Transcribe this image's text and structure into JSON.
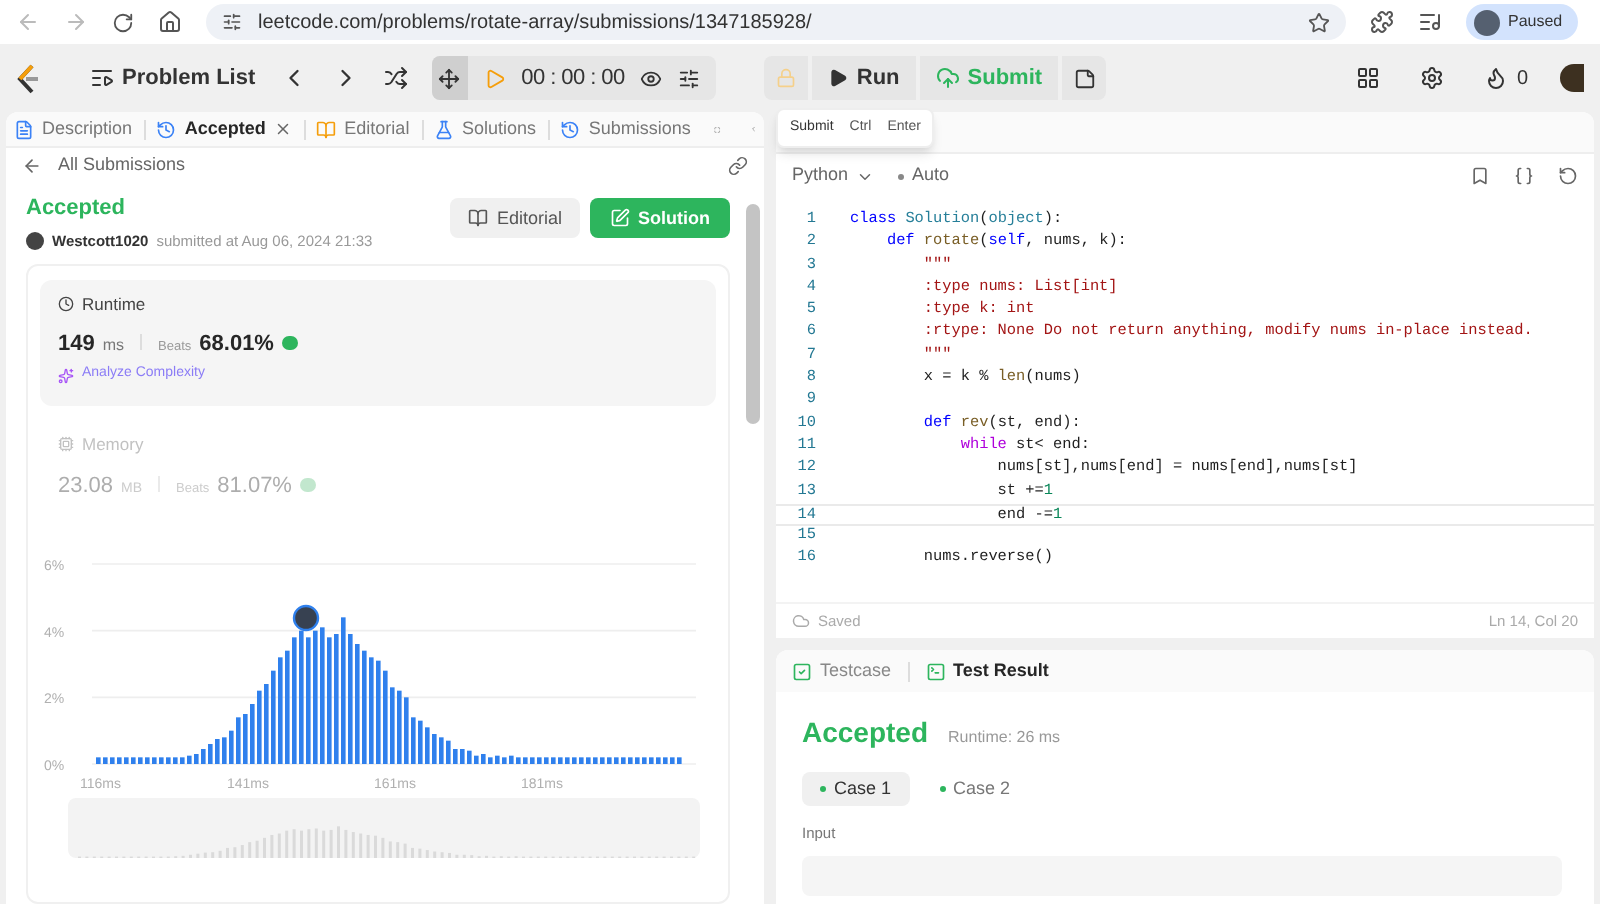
{
  "browser": {
    "url": "leetcode.com/problems/rotate-array/submissions/1347185928/",
    "profile": "Paused"
  },
  "toolbar": {
    "problem_list": "Problem List",
    "timer": "00 : 00 : 00",
    "run": "Run",
    "submit": "Submit",
    "points": "0"
  },
  "tooltip": {
    "label": "Submit",
    "keys": [
      "Ctrl",
      "Enter"
    ]
  },
  "left_tabs": [
    {
      "label": "Description",
      "selected": false
    },
    {
      "label": "Accepted",
      "selected": true
    },
    {
      "label": "Editorial",
      "selected": false
    },
    {
      "label": "Solutions",
      "selected": false
    },
    {
      "label": "Submissions",
      "selected": false
    }
  ],
  "back_link": "All Submissions",
  "submission": {
    "status": "Accepted",
    "user": "Westcott1020",
    "submitted": "submitted at Aug 06, 2024 21:33",
    "editorial_button": "Editorial",
    "solution_button": "Solution"
  },
  "runtime": {
    "title": "Runtime",
    "value": "149",
    "unit": "ms",
    "beats_label": "Beats",
    "beats": "68.01%",
    "analyze": "Analyze Complexity"
  },
  "memory": {
    "title": "Memory",
    "value": "23.08",
    "unit": "MB",
    "beats_label": "Beats",
    "beats": "81.07%"
  },
  "chart_data": {
    "type": "bar",
    "ylim": [
      0,
      6
    ],
    "yticks": [
      {
        "value": 0,
        "label": "0%"
      },
      {
        "value": 2,
        "label": "2%"
      },
      {
        "value": 4,
        "label": "4%"
      },
      {
        "value": 6,
        "label": "6%"
      }
    ],
    "categories": [
      "116ms",
      null,
      null,
      null,
      null,
      null,
      null,
      null,
      null,
      null,
      null,
      null,
      null,
      null,
      null,
      null,
      null,
      null,
      null,
      null,
      null,
      "141ms",
      null,
      null,
      null,
      null,
      null,
      null,
      null,
      null,
      null,
      null,
      null,
      null,
      null,
      null,
      null,
      null,
      null,
      null,
      null,
      null,
      "161ms",
      null,
      null,
      null,
      null,
      null,
      null,
      null,
      null,
      null,
      null,
      null,
      null,
      null,
      null,
      null,
      null,
      null,
      null,
      null,
      null,
      "181ms",
      null,
      null,
      null,
      null,
      null,
      null,
      null,
      null,
      null,
      null,
      null,
      null,
      null,
      null,
      null,
      null,
      null,
      null,
      null,
      null
    ],
    "series": [
      {
        "color": "#2f80ed",
        "values": [
          0.2,
          0.2,
          0.2,
          0.2,
          0.2,
          0.2,
          0.2,
          0.2,
          0.2,
          0.2,
          0.2,
          0.2,
          0.2,
          0.25,
          0.3,
          0.45,
          0.6,
          0.75,
          0.8,
          1.0,
          1.4,
          1.5,
          1.8,
          2.2,
          2.4,
          2.8,
          3.2,
          3.4,
          3.8,
          4.0,
          3.8,
          4.0,
          4.1,
          3.8,
          3.9,
          4.4,
          3.9,
          3.6,
          3.4,
          3.2,
          3.1,
          2.8,
          2.3,
          2.2,
          2.0,
          1.4,
          1.3,
          1.1,
          0.9,
          0.8,
          0.7,
          0.45,
          0.45,
          0.4,
          0.25,
          0.3,
          0.2,
          0.25,
          0.2,
          0.25,
          0.2,
          0.2,
          0.2,
          0.2,
          0.2,
          0.2,
          0.2,
          0.2,
          0.2,
          0.2,
          0.2,
          0.2,
          0.2,
          0.2,
          0.2,
          0.2,
          0.2,
          0.2,
          0.2,
          0.2,
          0.2,
          0.2,
          0.2,
          0.2
        ]
      }
    ]
  },
  "editor": {
    "language": "Python",
    "mode": "Auto",
    "status": "Saved",
    "cursor": "Ln 14, Col 20",
    "lines": [
      {
        "n": "1",
        "current": false,
        "tokens": [
          {
            "kind": "kw",
            "text": "class "
          },
          {
            "kind": "type",
            "text": "Solution"
          },
          {
            "kind": "plain",
            "text": "("
          },
          {
            "kind": "type",
            "text": "object"
          },
          {
            "kind": "plain",
            "text": "):"
          }
        ]
      },
      {
        "n": "2",
        "current": false,
        "tokens": [
          {
            "kind": "kw",
            "text": "    def "
          },
          {
            "kind": "fn",
            "text": "rotate"
          },
          {
            "kind": "plain",
            "text": "("
          },
          {
            "kind": "kw",
            "text": "self"
          },
          {
            "kind": "plain",
            "text": ", nums, k):"
          }
        ]
      },
      {
        "n": "3",
        "current": false,
        "tokens": [
          {
            "kind": "str",
            "text": "        \"\"\""
          }
        ]
      },
      {
        "n": "4",
        "current": false,
        "tokens": [
          {
            "kind": "str",
            "text": "        :type nums: List[int]"
          }
        ]
      },
      {
        "n": "5",
        "current": false,
        "tokens": [
          {
            "kind": "str",
            "text": "        :type k: int"
          }
        ]
      },
      {
        "n": "6",
        "current": false,
        "tokens": [
          {
            "kind": "str",
            "text": "        :rtype: None Do not return anything, modify nums in-place instead."
          }
        ]
      },
      {
        "n": "7",
        "current": false,
        "tokens": [
          {
            "kind": "str",
            "text": "        \"\"\""
          }
        ]
      },
      {
        "n": "8",
        "current": false,
        "tokens": [
          {
            "kind": "plain",
            "text": "        x = k % "
          },
          {
            "kind": "fn",
            "text": "len"
          },
          {
            "kind": "plain",
            "text": "(nums)"
          }
        ]
      },
      {
        "n": "9",
        "current": false
      },
      {
        "n": "10",
        "current": false,
        "tokens": [
          {
            "kind": "kw",
            "text": "        def "
          },
          {
            "kind": "fn",
            "text": "rev"
          },
          {
            "kind": "plain",
            "text": "(st, end):"
          }
        ]
      },
      {
        "n": "11",
        "current": false,
        "tokens": [
          {
            "kind": "ctl",
            "text": "            while"
          },
          {
            "kind": "plain",
            "text": " st< end:"
          }
        ]
      },
      {
        "n": "12",
        "current": false,
        "tokens": [
          {
            "kind": "plain",
            "text": "                nums[st],nums[end] = nums[end],nums[st]"
          }
        ]
      },
      {
        "n": "13",
        "current": false,
        "tokens": [
          {
            "kind": "plain",
            "text": "                st +="
          },
          {
            "kind": "num",
            "text": "1"
          }
        ]
      },
      {
        "n": "14",
        "current": true,
        "tokens": [
          {
            "kind": "plain",
            "text": "                end -="
          },
          {
            "kind": "num",
            "text": "1"
          }
        ]
      },
      {
        "n": "15",
        "current": false
      },
      {
        "n": "16",
        "current": false,
        "tokens": [
          {
            "kind": "plain",
            "text": "        nums.reverse()"
          }
        ]
      }
    ]
  },
  "result_tabs": [
    {
      "label": "Testcase",
      "selected": false
    },
    {
      "label": "Test Result",
      "selected": true
    }
  ],
  "result": {
    "status": "Accepted",
    "runtime": "Runtime: 26 ms",
    "cases": [
      {
        "label": "Case 1",
        "selected": true
      },
      {
        "label": "Case 2",
        "selected": false
      }
    ],
    "input_label": "Input"
  }
}
